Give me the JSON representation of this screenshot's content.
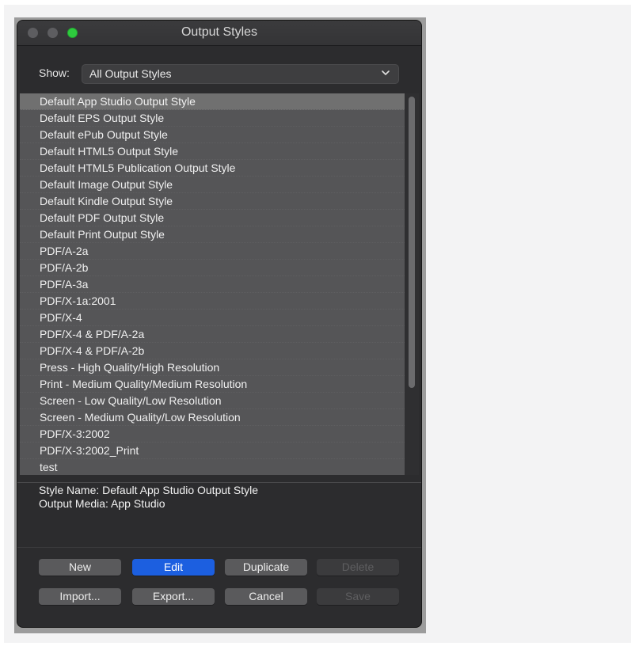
{
  "window": {
    "title": "Output Styles"
  },
  "show": {
    "label": "Show:",
    "selected": "All Output Styles"
  },
  "list": {
    "selected_index": 0,
    "items": [
      "Default App Studio Output Style",
      "Default EPS Output Style",
      "Default ePub Output Style",
      "Default HTML5 Output Style",
      "Default HTML5 Publication Output Style",
      "Default Image Output Style",
      "Default Kindle Output Style",
      "Default PDF Output Style",
      "Default Print Output Style",
      "PDF/A-2a",
      "PDF/A-2b",
      "PDF/A-3a",
      "PDF/X-1a:2001",
      "PDF/X-4",
      "PDF/X-4 & PDF/A-2a",
      "PDF/X-4 & PDF/A-2b",
      "Press - High Quality/High Resolution",
      "Print - Medium Quality/Medium Resolution",
      "Screen - Low Quality/Low Resolution",
      "Screen - Medium Quality/Low Resolution",
      "PDF/X-3:2002",
      "PDF/X-3:2002_Print",
      "test"
    ]
  },
  "info": {
    "style_name": "Style Name: Default App Studio Output Style",
    "output_media": "Output Media: App Studio"
  },
  "buttons": {
    "new": "New",
    "edit": "Edit",
    "duplicate": "Duplicate",
    "delete": "Delete",
    "import": "Import...",
    "export": "Export...",
    "cancel": "Cancel",
    "save": "Save"
  },
  "colors": {
    "window_bg": "#2c2c2e",
    "row_bg": "#555557",
    "row_selected": "#707070",
    "primary_button": "#1c5fe0",
    "zoom_button": "#2ecb3e"
  }
}
